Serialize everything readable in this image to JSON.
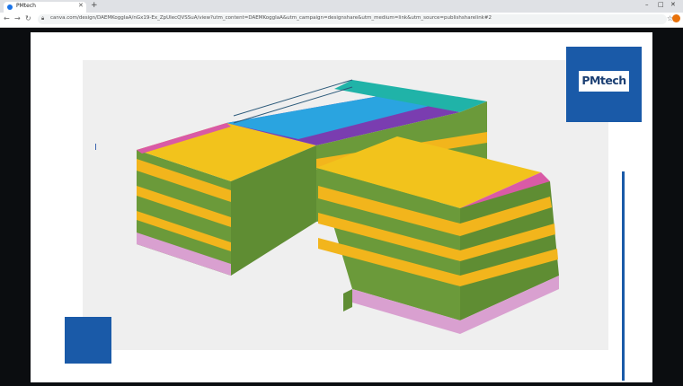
{
  "browser": {
    "tab_title": "PMtech",
    "url": "canva.com/design/DAEMKoggIaA/nGx19-Ex_ZpUIecQVSSuA/view?utm_content=DAEMKoggIaA&utm_campaign=designshare&utm_medium=link&utm_source=publishsharelink#2",
    "colors": {
      "tab_bg": "#dfe1e5",
      "profile": "#e8710a"
    }
  },
  "slide": {
    "logo_text": "PMtech",
    "colors": {
      "brand_blue": "#1a5aa8",
      "logo_text": "#1b3f73"
    }
  }
}
